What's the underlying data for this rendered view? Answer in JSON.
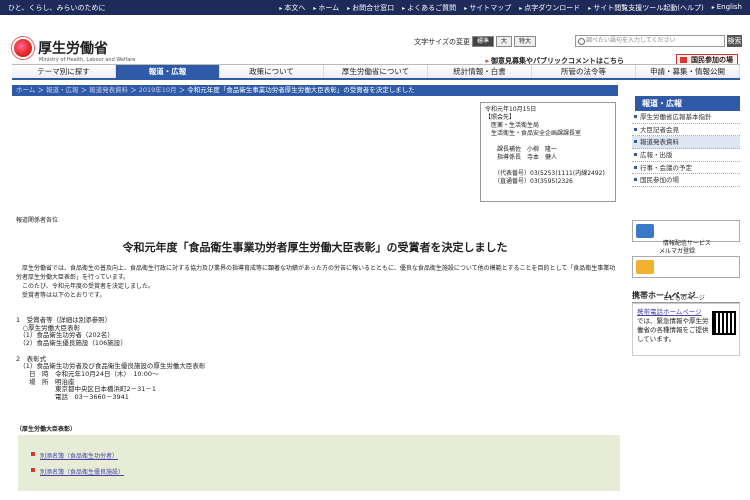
{
  "top": {
    "tagline": "ひと、くらし、みらいのために",
    "links": [
      "本文へ",
      "ホーム",
      "お問合せ窓口",
      "よくあるご質問",
      "サイトマップ",
      "点字ダウンロード",
      "サイト閲覧支援ツール起動(ヘルプ)",
      "English"
    ]
  },
  "logo": {
    "title": "厚生労働省",
    "sub": "Ministry of Health, Labour and Welfare"
  },
  "fontsize": {
    "label": "文字サイズの変更",
    "options": [
      "標準",
      "大",
      "特大"
    ]
  },
  "search": {
    "placeholder": "調べたい語句を入力してください",
    "button": "検索"
  },
  "opinion": "御意見募集やパブリックコメントはこちら",
  "kokkai": "国民参加の場",
  "nav": [
    "テーマ別に探す",
    "報道・広報",
    "政策について",
    "厚生労働省について",
    "統計情報・白書",
    "所管の法令等",
    "申請・募集・情報公開"
  ],
  "breadcrumb": [
    "ホーム",
    "報道・広報",
    "報道発表資料",
    "2019年10月",
    "令和元年度「食品衛生事業功労者厚生労働大臣表彰」の受賞者を決定しました"
  ],
  "contact": "令和元年10月15日\n【照会先】\n　医薬・生活衛生局\n　生活衛生・食品安全企画課課長室\n\n　　課長補佐　小柳　隆一\n　　指導係長　寺本　健人\n\n　　（代表番号）03(5253)1111(内線2492)\n　　（直通番号）03(3595)2326",
  "recipient": "報道関係者各位",
  "heading": "令和元年度「食品衛生事業功労者厚生労働大臣表彰」の受賞者を決定しました",
  "body": [
    "厚生労働省では、食品衛生の普及向上、食品衛生行政に対する協力及び業界の指導育成等に顕著な功績があった方の労苦に報いるとともに、優良な食品衛生施設について他の模範とすることを目的として「食品衛生事業功労者厚生労働大臣表彰」を行っています。",
    "このたび、令和元年度の受賞者を決定しました。",
    "受賞者等は以下のとおりです。"
  ],
  "items": "1　受賞者等（詳細は別添参照）\n　○厚生労働大臣表彰\n　（1）食品衛生功労者（202名）\n　（2）食品衛生優良施設（106施設）\n\n2　表彰式\n　（1）食品衛生功労者及び食品衛生優良施設の厚生労働大臣表彰\n　　日　時　令和元年10月24日（木）　10:00～\n　　場　所　明治座\n　　　　　　東京都中央区日本橋浜町2－31－1\n　　　　　　電話　03－3660－3941",
  "prizes_label": "（厚生労働大臣表彰）",
  "attachments": [
    "別添名簿（食品衛生功労者）",
    "別添名簿（食品衛生優良施設）"
  ],
  "side": {
    "header": "報道・広報",
    "items": [
      "厚生労働省広報基本指針",
      "大臣記者会見",
      "報道発表資料",
      "広報・出版",
      "行事・会議の予定",
      "国民参加の場"
    ]
  },
  "banners": [
    {
      "text": "情報配信サービス\nメルマガ登録"
    },
    {
      "text": "こどものページ"
    }
  ],
  "mobile": {
    "heading": "携帯ホームページ",
    "link": "携帯電話ホームページ",
    "text": "では、緊急情報や厚生労働省の各種情報をご提供しています。"
  }
}
